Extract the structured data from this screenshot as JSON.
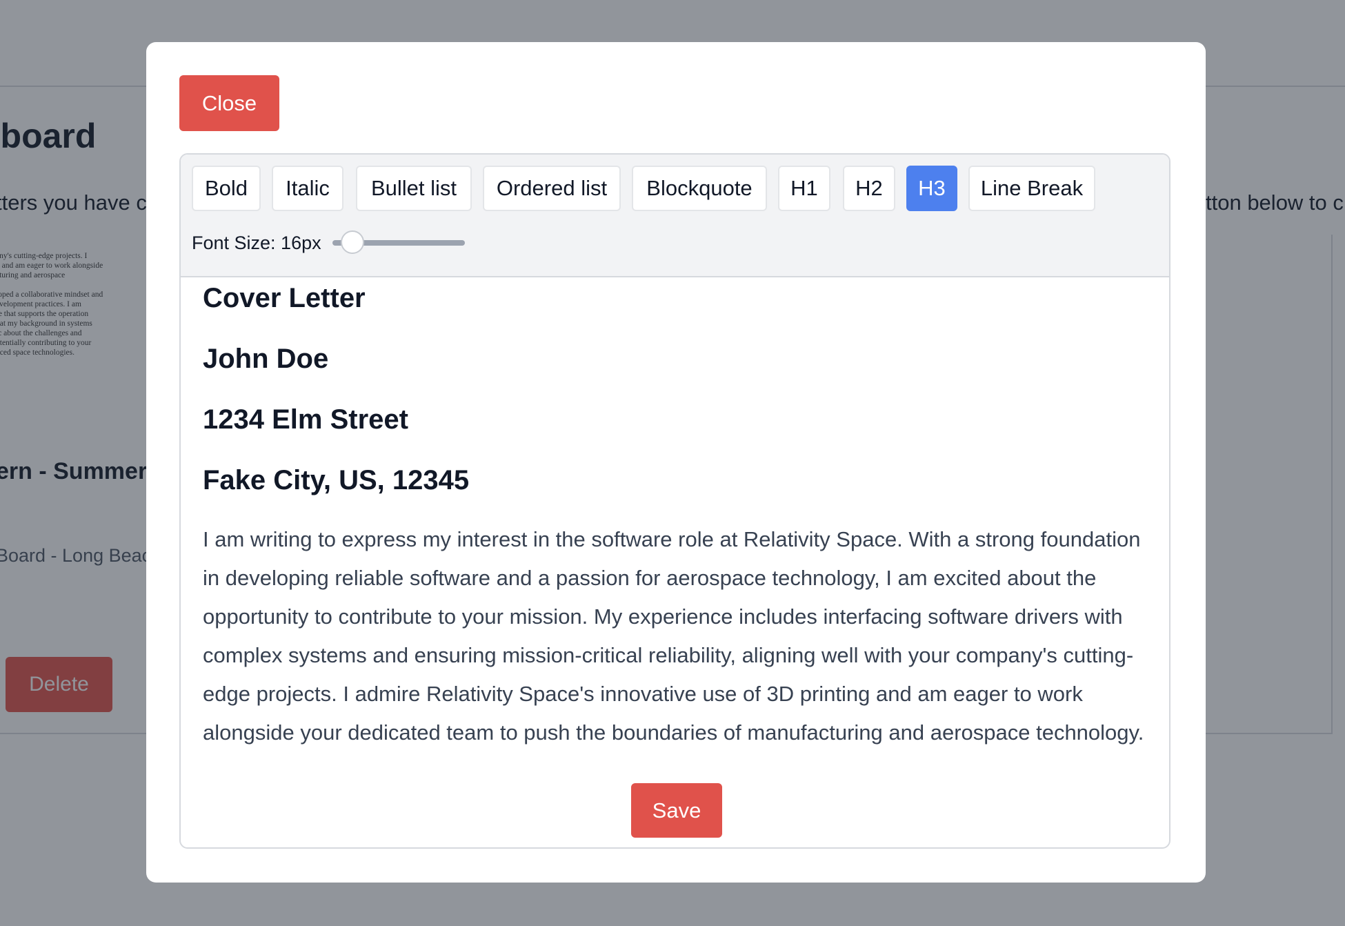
{
  "background": {
    "title_fragment": "nboard",
    "intro_left_fragment": "tters you have c",
    "intro_right_fragment": "tton below to c",
    "thumbnail_lines": [
      "any's cutting-edge projects. I",
      "g and am eager to work alongside",
      "cturing and aerospace",
      "loped a collaborative mindset and",
      "evelopment practices. I am",
      "re that supports the operation",
      "hat my background in systems",
      "ic about the challenges and",
      "otentially contributing to your",
      "nced space technologies."
    ],
    "job_title_fragment": "ern - Summer",
    "job_location_fragment": "Board - Long Beac",
    "delete_label": "Delete"
  },
  "modal": {
    "close_label": "Close",
    "toolbar": {
      "buttons": [
        {
          "label": "Bold",
          "active": false
        },
        {
          "label": "Italic",
          "active": false
        },
        {
          "label": "Bullet list",
          "active": false
        },
        {
          "label": "Ordered list",
          "active": false
        },
        {
          "label": "Blockquote",
          "active": false
        },
        {
          "label": "H1",
          "active": false
        },
        {
          "label": "H2",
          "active": false
        },
        {
          "label": "H3",
          "active": true
        },
        {
          "label": "Line Break",
          "active": false
        }
      ],
      "font_size_label": "Font Size: 16px",
      "font_size_value": 16
    },
    "content": {
      "headings": [
        "Cover Letter",
        "John Doe",
        "1234 Elm Street",
        "Fake City, US, 12345"
      ],
      "paragraph": "I am writing to express my interest in the software role at Relativity Space. With a strong foundation in developing reliable software and a passion for aerospace technology, I am excited about the opportunity to contribute to your mission. My experience includes interfacing software drivers with complex systems and ensuring mission-critical reliability, aligning well with your company's cutting-edge projects. I admire Relativity Space's innovative use of 3D printing and am eager to work alongside your dedicated team to push the boundaries of manufacturing and aerospace technology."
    },
    "save_label": "Save"
  },
  "colors": {
    "danger": "#e0524b",
    "active": "#4d80ee",
    "overlay": "rgba(35, 43, 56, 0.5)"
  }
}
